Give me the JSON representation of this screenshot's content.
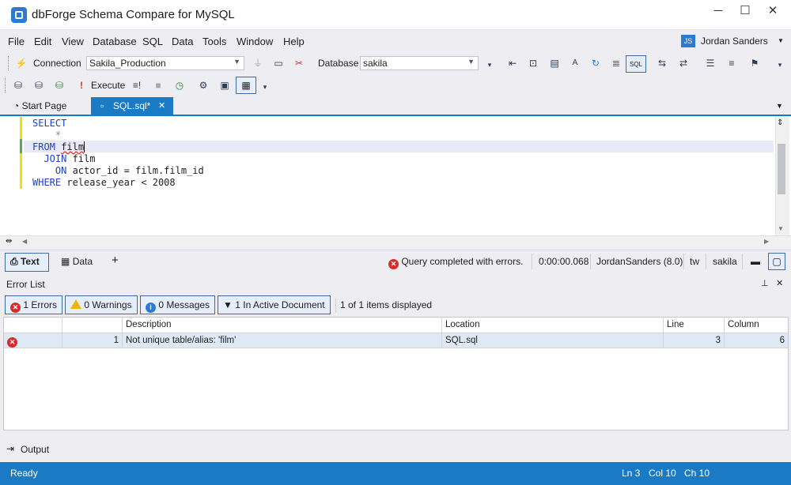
{
  "app": {
    "title": "dbForge Schema Compare for MySQL"
  },
  "window": {
    "minimize": "─",
    "maximize": "☐",
    "close": "✕"
  },
  "menu": {
    "items": [
      "File",
      "Edit",
      "View",
      "Database",
      "SQL",
      "Data",
      "Tools",
      "Window",
      "Help"
    ]
  },
  "user": {
    "initials": "JS",
    "name": "Jordan Sanders"
  },
  "toolbar1": {
    "connection_label": "Connection",
    "connection_value": "Sakila_Production",
    "database_label": "Database",
    "database_value": "sakila"
  },
  "toolbar2": {
    "execute_label": "Execute"
  },
  "tabs": {
    "start": "Start Page",
    "sql": "SQL.sql*",
    "close": "✕"
  },
  "editor": {
    "lines": [
      {
        "kw": "SELECT",
        "rest": ""
      },
      {
        "kw": "",
        "rest": "    *"
      },
      {
        "kw": "FROM",
        "rest": " ",
        "sq": "film"
      },
      {
        "kw": "  JOIN",
        "rest": " film"
      },
      {
        "kw": "    ON",
        "rest": " actor_id = film.film_id"
      },
      {
        "kw": "WHERE",
        "rest": " release_year < 2008"
      }
    ]
  },
  "results": {
    "text_tab": "Text",
    "data_tab": "Data",
    "add": "+",
    "status": "Query completed with errors.",
    "time": "0:00:00.068",
    "user": "JordanSanders (8.0)",
    "tw": "tw",
    "db": "sakila"
  },
  "error_list": {
    "title": "Error List",
    "pin": "⊥",
    "close": "✕",
    "errors_btn": "1 Errors",
    "warnings_btn": "0 Warnings",
    "messages_btn": "0 Messages",
    "active_doc_btn": "1 In Active Document",
    "count_text": "1 of 1 items displayed",
    "columns": [
      "",
      "",
      "Description",
      "Location",
      "Line",
      "Column"
    ],
    "rows": [
      {
        "num": "1",
        "description": "Not unique table/alias: 'film'",
        "location": "SQL.sql",
        "line": "3",
        "column": "6"
      }
    ]
  },
  "output": {
    "label": "Output"
  },
  "status": {
    "ready": "Ready",
    "ln": "Ln 3",
    "col": "Col 10",
    "ch": "Ch 10"
  },
  "colors": {
    "accent": "#1b7ac4",
    "error": "#d92b2b",
    "warning": "#f0b400",
    "keyword": "#1a3fd4"
  }
}
